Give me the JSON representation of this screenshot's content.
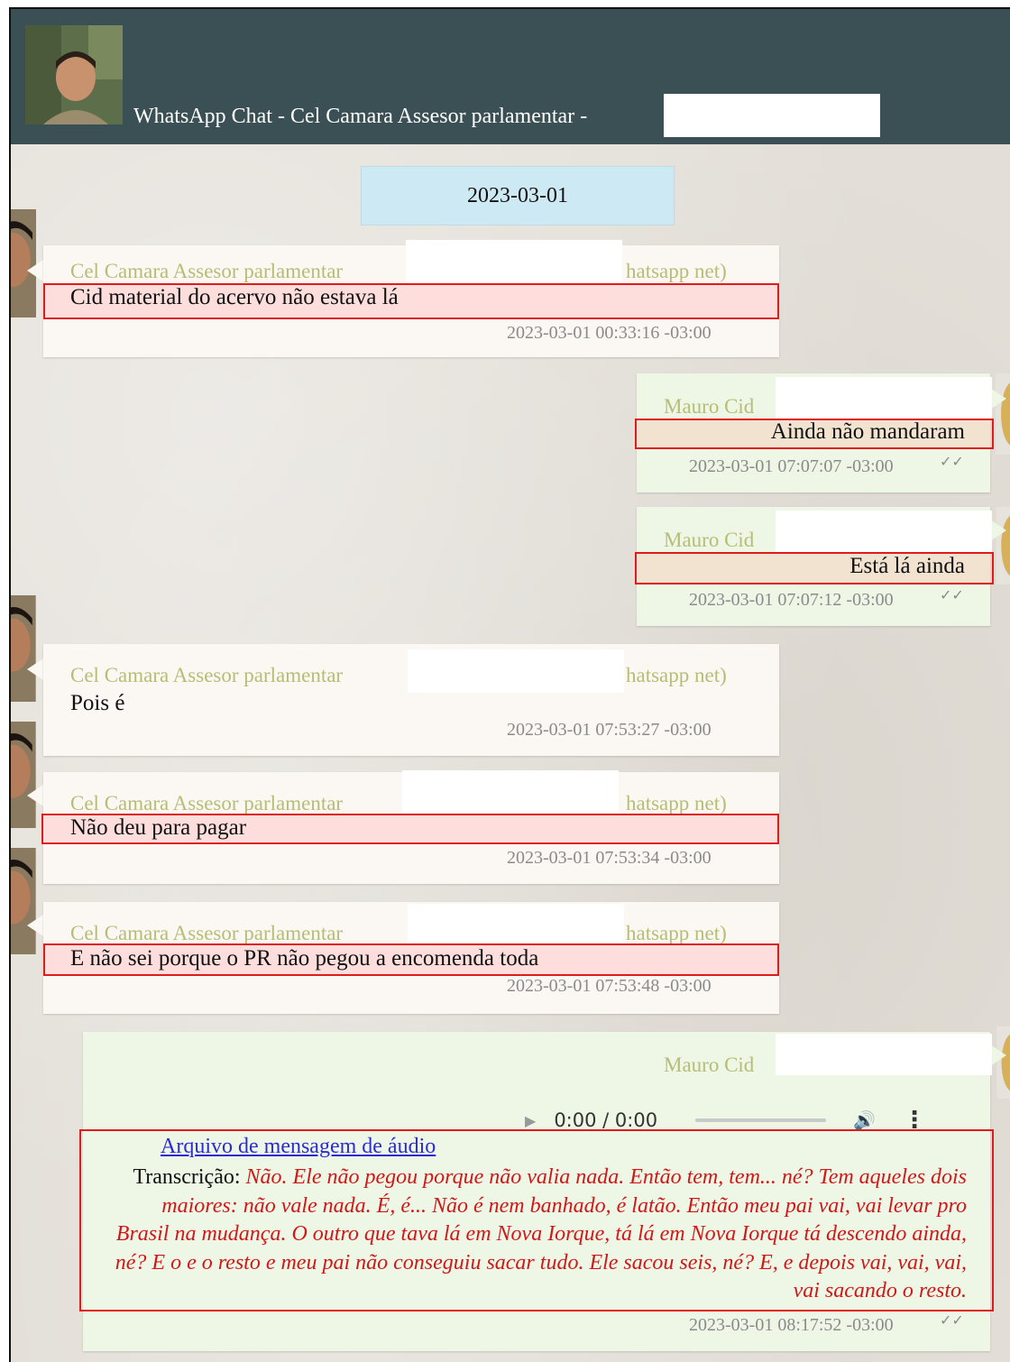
{
  "header": {
    "title": "WhatsApp Chat - Cel Camara Assesor parlamentar -"
  },
  "date_separator": "2023-03-01",
  "messages": [
    {
      "direction": "incoming",
      "sender": "Cel Camara Assesor parlamentar",
      "sender_suffix": "hatsapp net)",
      "text": "Cid material do acervo não estava lá",
      "timestamp": "2023-03-01 00:33:16 -03:00",
      "highlighted": true
    },
    {
      "direction": "outgoing",
      "sender": "Mauro Cid",
      "text": "Ainda não mandaram",
      "timestamp": "2023-03-01 07:07:07 -03:00",
      "ticks": "✓✓",
      "highlighted": true
    },
    {
      "direction": "outgoing",
      "sender": "Mauro Cid",
      "text": "Está lá ainda",
      "timestamp": "2023-03-01 07:07:12 -03:00",
      "ticks": "✓✓",
      "highlighted": true
    },
    {
      "direction": "incoming",
      "sender": "Cel Camara Assesor parlamentar",
      "sender_suffix": "hatsapp net)",
      "text": "Pois é",
      "timestamp": "2023-03-01 07:53:27 -03:00",
      "highlighted": false
    },
    {
      "direction": "incoming",
      "sender": "Cel Camara Assesor parlamentar",
      "sender_suffix": "hatsapp net)",
      "text": "Não deu para pagar",
      "timestamp": "2023-03-01 07:53:34 -03:00",
      "highlighted": true
    },
    {
      "direction": "incoming",
      "sender": "Cel Camara Assesor parlamentar",
      "sender_suffix": "hatsapp net)",
      "text": "E não sei porque o PR não pegou a encomenda toda",
      "timestamp": "2023-03-01 07:53:48 -03:00",
      "highlighted": true
    }
  ],
  "audio_message": {
    "sender": "Mauro Cid",
    "player_time": "0:00 / 0:00",
    "link_text": "Arquivo de mensagem de áudio",
    "transcription_label": "Transcrição:",
    "transcription_text": "Não. Ele não pegou porque não valia nada. Então tem, tem... né? Tem aqueles dois maiores: não vale nada. É, é... Não é nem banhado, é latão. Então meu pai vai, vai levar pro Brasil na mudança. O outro que tava lá em Nova Iorque, tá lá em Nova Iorque tá descendo ainda, né? E o e o resto e meu pai não conseguiu sacar tudo. Ele sacou seis, né? E, e depois vai, vai, vai, vai sacando o resto.",
    "timestamp": "2023-03-01 08:17:52 -03:00",
    "ticks": "✓✓"
  },
  "icons": {
    "play": "▶",
    "volume": "🔊",
    "more": "⋮"
  },
  "colors": {
    "header_bg": "#3a5055",
    "date_bg": "#cde9f4",
    "highlight_border": "#e01b1b",
    "transcription_text": "#d01818",
    "sender_name": "#b6bd74"
  }
}
